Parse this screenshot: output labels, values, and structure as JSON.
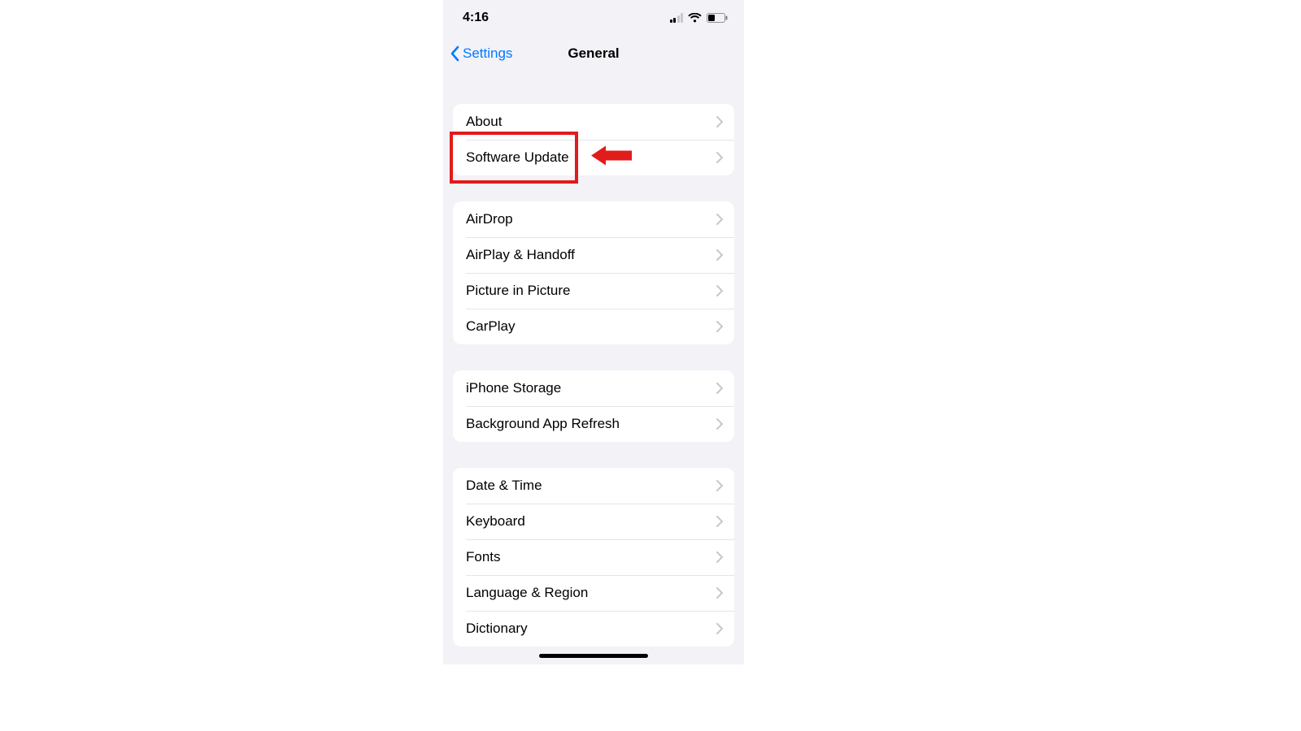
{
  "status": {
    "time": "4:16"
  },
  "nav": {
    "back_label": "Settings",
    "title": "General"
  },
  "groups": [
    {
      "rows": [
        {
          "label": "About",
          "highlight": false
        },
        {
          "label": "Software Update",
          "highlight": true
        }
      ]
    },
    {
      "rows": [
        {
          "label": "AirDrop"
        },
        {
          "label": "AirPlay & Handoff"
        },
        {
          "label": "Picture in Picture"
        },
        {
          "label": "CarPlay"
        }
      ]
    },
    {
      "rows": [
        {
          "label": "iPhone Storage"
        },
        {
          "label": "Background App Refresh"
        }
      ]
    },
    {
      "rows": [
        {
          "label": "Date & Time"
        },
        {
          "label": "Keyboard"
        },
        {
          "label": "Fonts"
        },
        {
          "label": "Language & Region"
        },
        {
          "label": "Dictionary"
        }
      ]
    }
  ],
  "annotation": {
    "highlight_color": "#e21b1b"
  }
}
